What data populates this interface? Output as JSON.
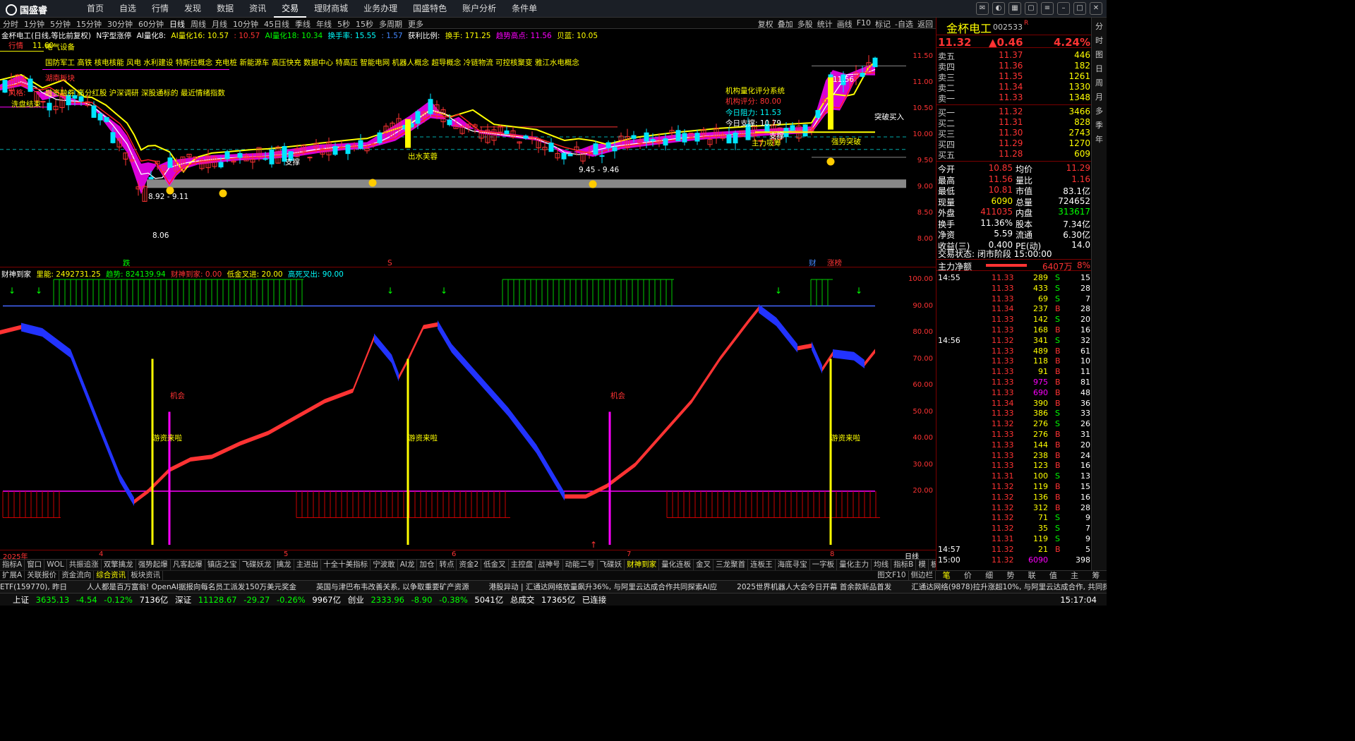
{
  "app": {
    "logo": "国盛睿"
  },
  "menu": [
    "首页",
    "自选",
    "行情",
    "发现",
    "数据",
    "资讯",
    "交易",
    "理财商城",
    "业务办理",
    "国盛特色",
    "账户分析",
    "条件单"
  ],
  "menu_active": "交易",
  "periods": [
    "分时",
    "1分钟",
    "5分钟",
    "15分钟",
    "30分钟",
    "60分钟",
    "日线",
    "周线",
    "月线",
    "10分钟",
    "45日线",
    "季线",
    "年线",
    "5秒",
    "15秒",
    "多周期",
    "更多"
  ],
  "period_active": "日线",
  "tools": [
    "复权",
    "叠加",
    "多股",
    "统计",
    "画线",
    "F10",
    "标记",
    "-自选",
    "返回"
  ],
  "kline_info": {
    "stock": "金杯电工(日线,等比前复权)",
    "n_pattern": "N字型涨停",
    "ai8": "AI量化8: ",
    "ai16": "AI量化16: 10.57",
    "v1": ": 10.57",
    "ai18": "AI量化18: 10.34",
    "turnover": "换手率: 15.55",
    "v2": ": 1.57",
    "profit_ratio": "获利比例: ",
    "hands": "换手: 171.25",
    "trend_high": "趋势高点: 11.56",
    "cost": "贝蓝: 10.05"
  },
  "chart_overlays": {
    "tags": [
      "行情",
      "电气设备",
      "国防军工 高铁 核电核能 风电 水利建设 特斯拉概念 充电桩 新能源车 高压快充 数据中心 特高压 智能电网 机器人概念 超导概念 冷链物流 可控核聚变 雅江水电概念",
      "湖南板块",
      "融资融券 高分红股 沪深调研 深股通标的 最近情绪指数",
      "风格:",
      "洗盘结束"
    ],
    "top_price": "11.60",
    "texts": {
      "sys": "机构量化评分系统",
      "score": "机构评分: 80.00",
      "resist": "今日阻力: 11.53",
      "support": "今日支撑: 10.79",
      "break_buy": "突破买入",
      "strong": "强势突破",
      "main_buy": "主力吸筹",
      "support1": "支撑",
      "support2": "支撑",
      "cloud": "出水芙蓉",
      "range1": "8.92 - 9.11",
      "range2": "9.45 - 9.46",
      "low": "8.06",
      "high": "11.56",
      "fall": "跌",
      "s_mark": "S",
      "cai": "财",
      "zhangting": "涨榜"
    }
  },
  "axis1": [
    "11.50",
    "11.00",
    "10.50",
    "10.00",
    "9.50",
    "9.00",
    "8.50",
    "8.00"
  ],
  "ind2_info": {
    "name": "财神到家",
    "lines": "里能: 2492731.25",
    "trend": "趋势: 824139.94",
    "cai": "财神到家: 0.00",
    "low": "低金叉进: 20.00",
    "high": "高死叉出: 90.00"
  },
  "axis2": [
    "100.00",
    "90.00",
    "80.00",
    "70.00",
    "60.00",
    "50.00",
    "40.00",
    "30.00",
    "20.00"
  ],
  "ind2_labels": {
    "chance1": "机会",
    "chance2": "机会",
    "hot1": "游资来啦",
    "hot2": "游资来啦",
    "hot3": "游资来啦"
  },
  "dates": [
    "2025年",
    "4",
    "5",
    "6",
    "7",
    "8"
  ],
  "date_right": "日线",
  "indicator_tabs": [
    "指标A",
    "窗口",
    "WOL",
    "共振追涨",
    "双擎擒龙",
    "强势起爆",
    "凡客起爆",
    "镇店之宝",
    "飞碟妖龙",
    "擒龙",
    "主进出",
    "十全十美指标",
    "宁波敢",
    "AI龙",
    "加仓",
    "转点",
    "资金2",
    "低金叉",
    "主控盘",
    "战神号",
    "动能二号",
    "飞碟妖",
    "财神到家",
    "量化连板",
    "金叉",
    "三龙聚首",
    "连板王",
    "海底寻宝",
    "一字板",
    "量化主力",
    "均线"
  ],
  "indicator_tab_active": "财神到家",
  "indicator_tab_right": [
    "指标B",
    "模",
    "板"
  ],
  "sub_tabs": [
    "扩展A",
    "关联报价",
    "资金流向",
    "综合资讯",
    "板块资讯"
  ],
  "sub_tab_active": "综合资讯",
  "sub_tabs_right": [
    "图文F10",
    "侧边栏"
  ],
  "news": [
    "ETF(159770), 昨日",
    "人人都是百万富翁! OpenAI据报向每名员工派发150万美元奖金",
    "英国与津巴布韦改善关系, 以争取重要矿产资源",
    "港股异动 | 汇通达网络放量飙升36%, 与阿里云达成合作共同探索AI应",
    "2025世界机器人大会今日开幕 首余款新品首发",
    "汇通达网络(9878)拉升涨超10%, 与阿里云达成合作, 共同探索人工智"
  ],
  "status": {
    "sh_label": "上证",
    "sh_val": "3635.13",
    "sh_chg": "-4.54",
    "sh_pct": "-0.12%",
    "sh_amt": "7136亿",
    "sz_label": "深证",
    "sz_val": "11128.67",
    "sz_chg": "-29.27",
    "sz_pct": "-0.26%",
    "sz_amt": "9967亿",
    "cy_label": "创业",
    "cy_val": "2333.96",
    "cy_chg": "-8.90",
    "cy_pct": "-0.38%",
    "cy_amt": "5041亿",
    "total_label": "总成交",
    "total_val": "17365亿",
    "conn": "已连接",
    "time": "15:17:04"
  },
  "quote": {
    "name": "金杯电工",
    "code": "002533",
    "flag": "R",
    "price": "11.32",
    "change": "▲0.46",
    "pct": "4.24%",
    "asks": [
      {
        "label": "卖五",
        "price": "11.37",
        "vol": "446"
      },
      {
        "label": "卖四",
        "price": "11.36",
        "vol": "182"
      },
      {
        "label": "卖三",
        "price": "11.35",
        "vol": "1261"
      },
      {
        "label": "卖二",
        "price": "11.34",
        "vol": "1330"
      },
      {
        "label": "卖一",
        "price": "11.33",
        "vol": "1348"
      }
    ],
    "bids": [
      {
        "label": "买一",
        "price": "11.32",
        "vol": "3466"
      },
      {
        "label": "买二",
        "price": "11.31",
        "vol": "828"
      },
      {
        "label": "买三",
        "price": "11.30",
        "vol": "2743"
      },
      {
        "label": "买四",
        "price": "11.29",
        "vol": "1270"
      },
      {
        "label": "买五",
        "price": "11.28",
        "vol": "609"
      }
    ],
    "stats": [
      {
        "l1": "今开",
        "v1": "10.85",
        "l2": "均价",
        "v2": "11.29"
      },
      {
        "l1": "最高",
        "v1": "11.56",
        "l2": "量比",
        "v2": "1.16"
      },
      {
        "l1": "最低",
        "v1": "10.81",
        "l2": "市值",
        "v2": "83.1亿"
      },
      {
        "l1": "现量",
        "v1": "6090",
        "l2": "总量",
        "v2": "724652"
      },
      {
        "l1": "外盘",
        "v1": "411035",
        "l2": "内盘",
        "v2": "313617"
      },
      {
        "l1": "换手",
        "v1": "11.36%",
        "l2": "股本",
        "v2": "7.34亿"
      },
      {
        "l1": "净资",
        "v1": "5.59",
        "l2": "流通",
        "v2": "6.30亿"
      },
      {
        "l1": "收益(三)",
        "v1": "0.400",
        "l2": "PE(动)",
        "v2": "14.0"
      }
    ],
    "trade_status": "交易状态: 闭市阶段 15:00:00",
    "main_flow_label": "主力净额",
    "main_flow_val": "6407万",
    "main_flow_pct": "8%",
    "ticks": [
      {
        "t": "14:55",
        "p": "11.33",
        "v": "289",
        "s": "S",
        "n": "15"
      },
      {
        "t": "",
        "p": "11.33",
        "v": "433",
        "s": "S",
        "n": "28"
      },
      {
        "t": "",
        "p": "11.33",
        "v": "69",
        "s": "S",
        "n": "7"
      },
      {
        "t": "",
        "p": "11.34",
        "v": "237",
        "s": "B",
        "n": "28"
      },
      {
        "t": "",
        "p": "11.33",
        "v": "142",
        "s": "S",
        "n": "20"
      },
      {
        "t": "",
        "p": "11.33",
        "v": "168",
        "s": "B",
        "n": "16"
      },
      {
        "t": "14:56",
        "p": "11.32",
        "v": "341",
        "s": "S",
        "n": "32"
      },
      {
        "t": "",
        "p": "11.33",
        "v": "489",
        "s": "B",
        "n": "61"
      },
      {
        "t": "",
        "p": "11.33",
        "v": "118",
        "s": "B",
        "n": "10"
      },
      {
        "t": "",
        "p": "11.33",
        "v": "91",
        "s": "B",
        "n": "11"
      },
      {
        "t": "",
        "p": "11.33",
        "v": "975",
        "s": "B",
        "n": "81"
      },
      {
        "t": "",
        "p": "11.33",
        "v": "690",
        "s": "B",
        "n": "48"
      },
      {
        "t": "",
        "p": "11.34",
        "v": "390",
        "s": "B",
        "n": "36"
      },
      {
        "t": "",
        "p": "11.33",
        "v": "386",
        "s": "S",
        "n": "33"
      },
      {
        "t": "",
        "p": "11.32",
        "v": "276",
        "s": "S",
        "n": "26"
      },
      {
        "t": "",
        "p": "11.33",
        "v": "276",
        "s": "B",
        "n": "31"
      },
      {
        "t": "",
        "p": "11.33",
        "v": "144",
        "s": "B",
        "n": "20"
      },
      {
        "t": "",
        "p": "11.33",
        "v": "238",
        "s": "B",
        "n": "24"
      },
      {
        "t": "",
        "p": "11.33",
        "v": "123",
        "s": "B",
        "n": "16"
      },
      {
        "t": "",
        "p": "11.31",
        "v": "100",
        "s": "S",
        "n": "13"
      },
      {
        "t": "",
        "p": "11.32",
        "v": "119",
        "s": "B",
        "n": "15"
      },
      {
        "t": "",
        "p": "11.32",
        "v": "136",
        "s": "B",
        "n": "16"
      },
      {
        "t": "",
        "p": "11.32",
        "v": "312",
        "s": "B",
        "n": "28"
      },
      {
        "t": "",
        "p": "11.32",
        "v": "71",
        "s": "S",
        "n": "9"
      },
      {
        "t": "",
        "p": "11.32",
        "v": "35",
        "s": "S",
        "n": "7"
      },
      {
        "t": "",
        "p": "11.31",
        "v": "119",
        "s": "S",
        "n": "9"
      },
      {
        "t": "14:57",
        "p": "11.32",
        "v": "21",
        "s": "B",
        "n": "5"
      },
      {
        "t": "15:00",
        "p": "11.32",
        "v": "6090",
        "s": "",
        "n": "398"
      }
    ]
  },
  "right_tabs": [
    "笔",
    "价",
    "细",
    "势",
    "联",
    "值",
    "主",
    "筹"
  ],
  "right_tab_active": "笔",
  "sidebar_items": [
    "分",
    "时",
    "图",
    "日",
    "周",
    "月",
    "多",
    "季",
    "年"
  ]
}
